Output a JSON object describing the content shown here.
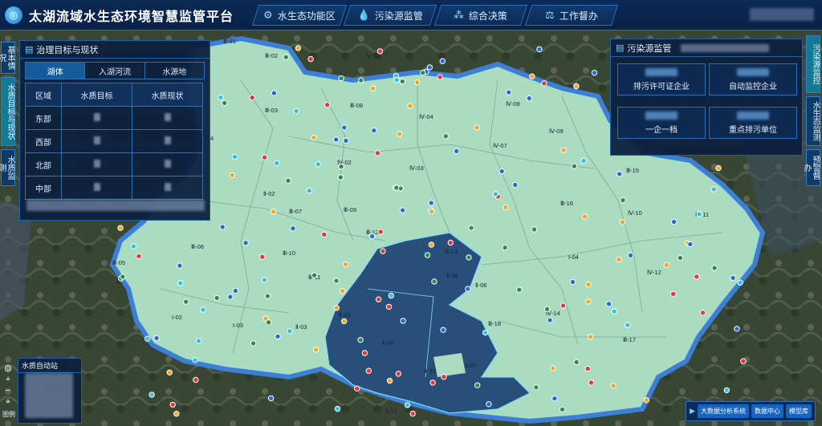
{
  "header": {
    "title": "太湖流域水生态环境智慧监管平台",
    "nav": [
      {
        "label": "水生态功能区",
        "icon": "settings-icon"
      },
      {
        "label": "污染源监管",
        "icon": "drop-icon"
      },
      {
        "label": "综合决策",
        "icon": "network-icon"
      },
      {
        "label": "工作督办",
        "icon": "gavel-icon"
      }
    ]
  },
  "left_tabs": [
    "基本情况",
    "水质目标与现状",
    "水质监测"
  ],
  "right_tabs": [
    "污染源监控",
    "水生态监测",
    "预警督办"
  ],
  "left_panel": {
    "title": "治理目标与现状",
    "tabs": [
      "湖体",
      "入湖河流",
      "水源地"
    ],
    "columns": [
      "区域",
      "水质目标",
      "水质现状"
    ],
    "rows": [
      {
        "region": "东部"
      },
      {
        "region": "西部"
      },
      {
        "region": "北部"
      },
      {
        "region": "中部"
      }
    ]
  },
  "right_panel": {
    "title": "污染源监管",
    "kpis": [
      {
        "label": "排污许可证企业"
      },
      {
        "label": "自动监控企业"
      },
      {
        "label": "一企一档"
      },
      {
        "label": "重点排污单位"
      }
    ]
  },
  "legend": {
    "title": "水质自动站"
  },
  "bottom": {
    "buttons": [
      "大数据分析系统",
      "数据中心",
      "模型库"
    ]
  },
  "map_tools": {
    "legend_label": "图例"
  },
  "map": {
    "zones": [
      "Ⅲ-01",
      "Ⅲ-02",
      "Ⅲ-03",
      "Ⅲ-04",
      "Ⅲ-05",
      "Ⅲ-06",
      "Ⅲ-07",
      "Ⅲ-08",
      "Ⅲ-09",
      "Ⅲ-10",
      "Ⅲ-11",
      "Ⅲ-12",
      "Ⅲ-13",
      "Ⅲ-15",
      "Ⅲ-16",
      "Ⅲ-17",
      "Ⅲ-18",
      "Ⅳ-01",
      "Ⅳ-02",
      "Ⅳ-03",
      "Ⅳ-04",
      "Ⅳ-07",
      "Ⅳ-08",
      "Ⅳ-09",
      "Ⅳ-10",
      "Ⅳ-11",
      "Ⅳ-12",
      "Ⅳ-14",
      "Ⅱ-02",
      "Ⅱ-03",
      "Ⅱ-05",
      "Ⅱ-06",
      "Ⅱ-08",
      "Ⅱ-09",
      "Ⅱ-10",
      "Ⅱ-20",
      "I-02",
      "I-03",
      "I-04",
      "I-05"
    ]
  },
  "colors": {
    "land": "#a9dcc0",
    "lake": "#274f7a",
    "boundary": "#3b7fd6",
    "sat": "#3c4a3a"
  }
}
